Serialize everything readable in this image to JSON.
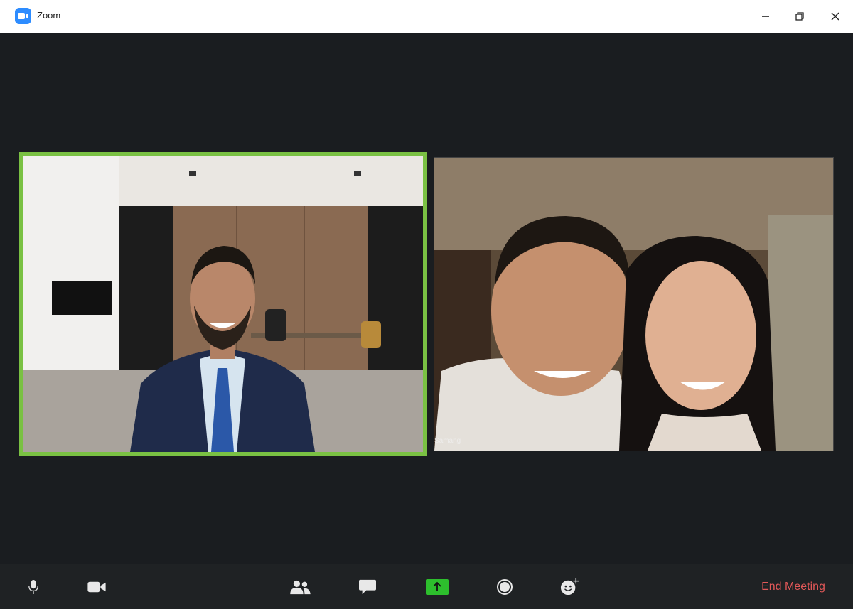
{
  "window": {
    "title": "Zoom"
  },
  "participants": [
    {
      "active_speaker": true
    },
    {
      "name": "Samang",
      "active_speaker": false
    }
  ],
  "toolbar": {
    "end_label": "End Meeting"
  },
  "colors": {
    "active_speaker_border": "#7ac143",
    "share_button": "#2dbf2d",
    "end_meeting": "#e25858",
    "app_logo": "#2d8cff"
  }
}
